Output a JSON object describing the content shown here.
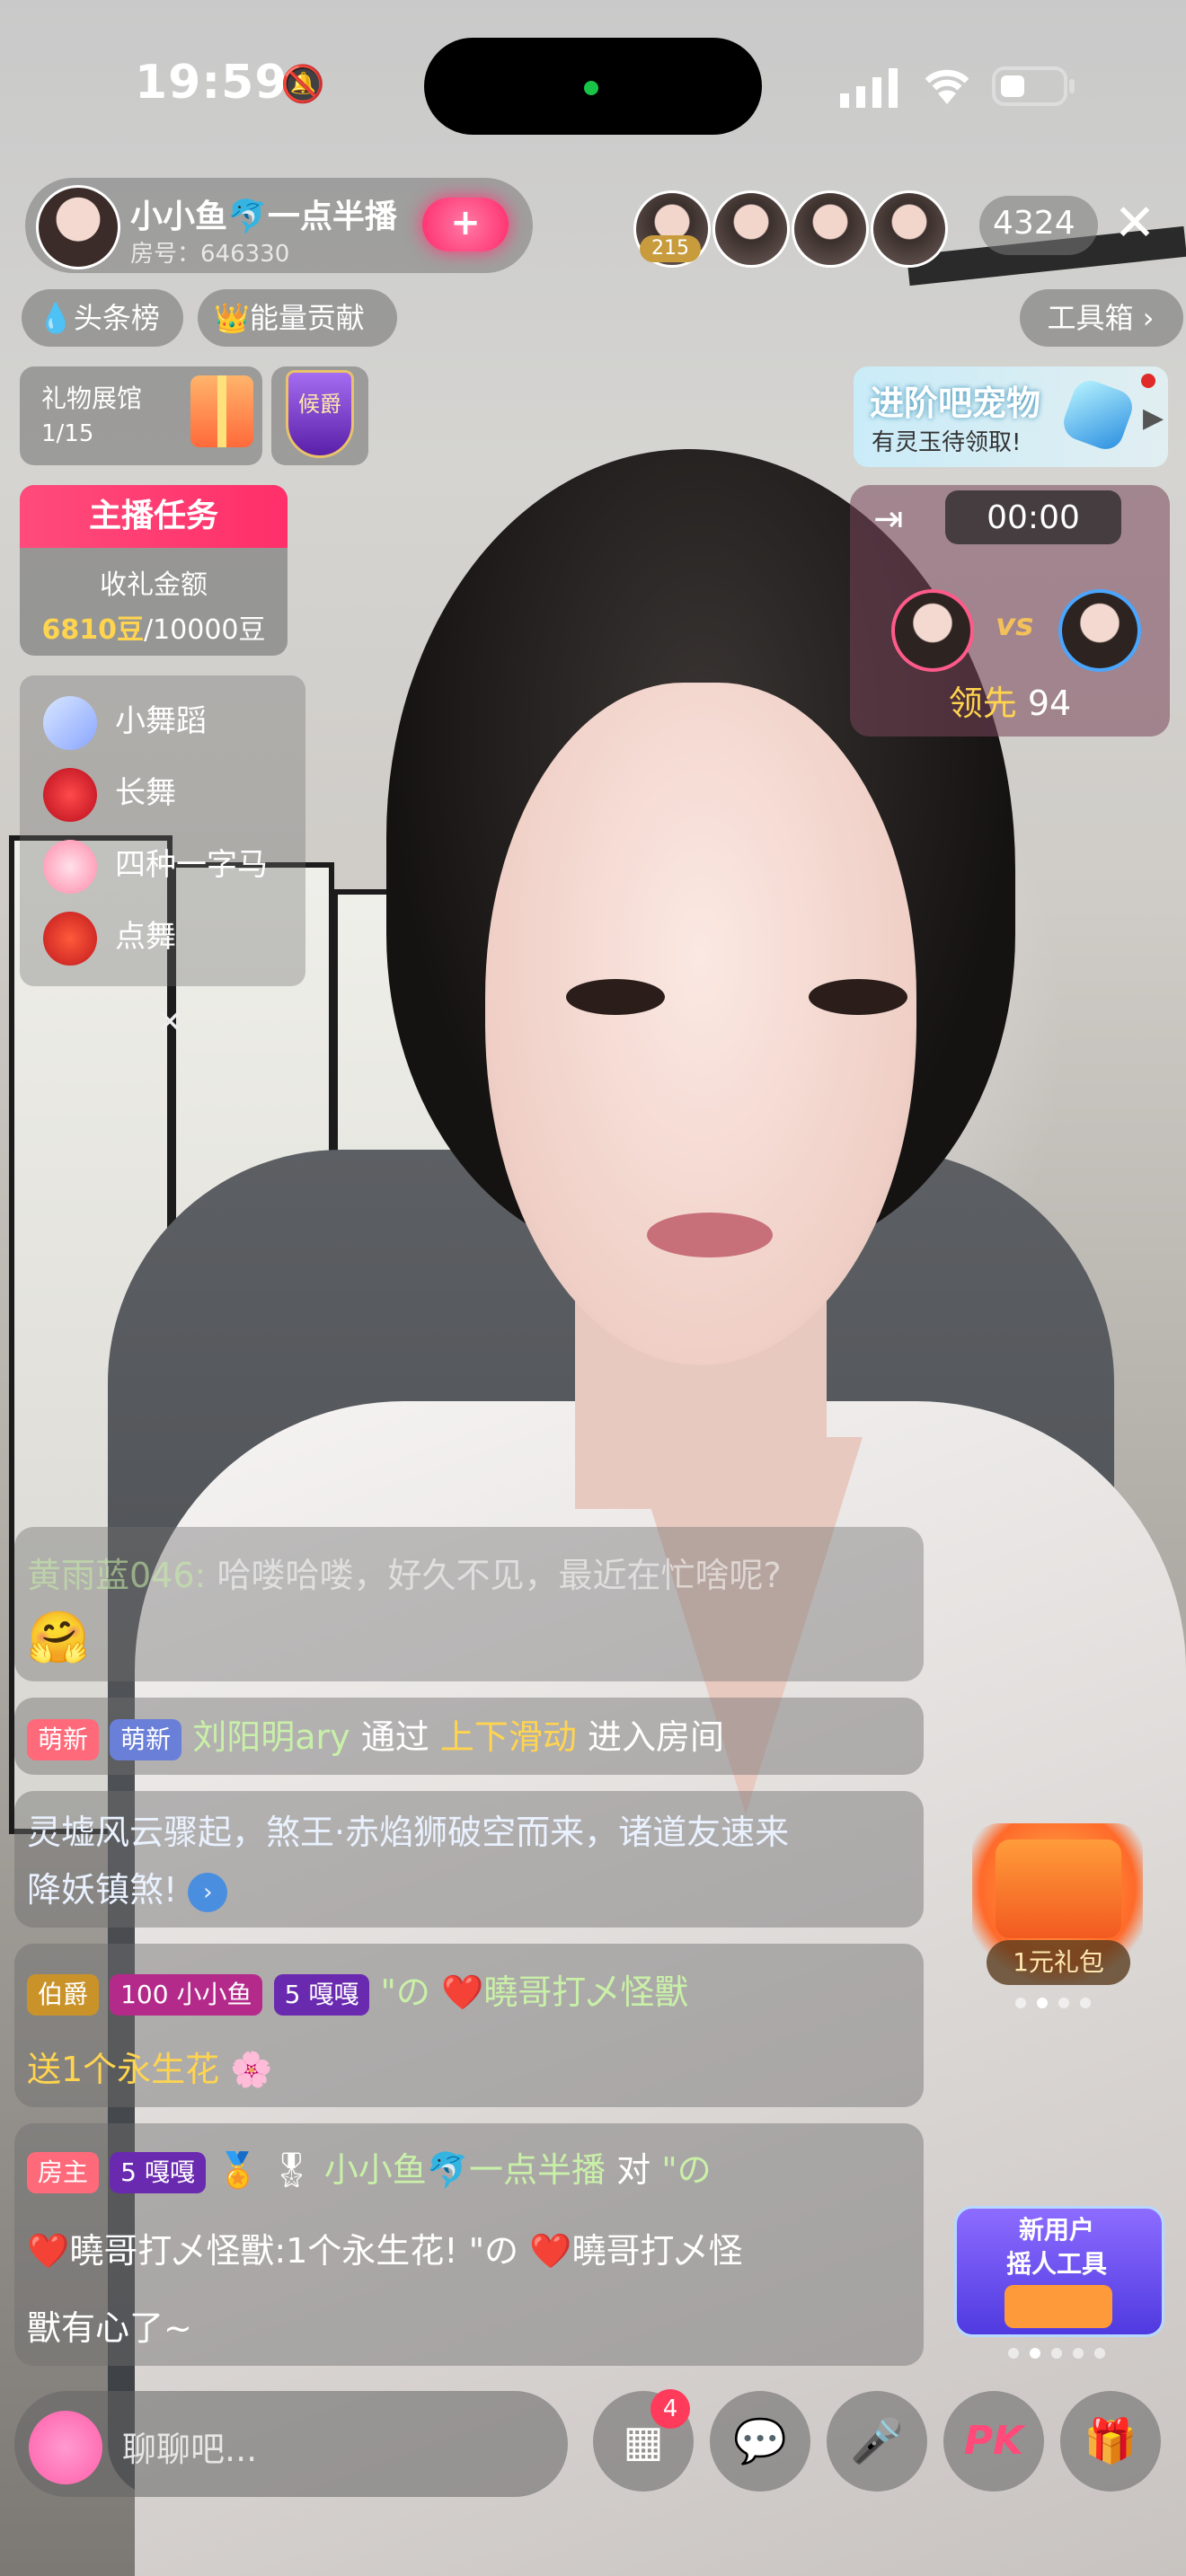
{
  "status_bar": {
    "time": "19:59"
  },
  "host": {
    "name": "小小鱼🐬一点半播",
    "room": "房号：646330",
    "follow_label": "+"
  },
  "viewers": {
    "badge": "215",
    "count": "4324"
  },
  "chips": {
    "headline": "头条榜",
    "energy": "能量贡献",
    "toolbox": "工具箱"
  },
  "gift_hall": {
    "title": "礼物展馆",
    "count": "1/15"
  },
  "rank_badge": {
    "label": "候爵"
  },
  "pet_promo": {
    "title": "进阶吧宠物",
    "subtitle": "有灵玉待领取!"
  },
  "host_task": {
    "title": "主播任务",
    "label": "收礼金额",
    "current": "6810豆",
    "target": "/10000豆"
  },
  "pk": {
    "timer": "00:00",
    "vs": "vs",
    "lead_label": "领先",
    "lead_value": "94"
  },
  "dance_menu": {
    "items": [
      "小舞蹈",
      "长舞",
      "四种一字马",
      "点舞"
    ]
  },
  "chat": {
    "msg1_user": "黄雨蓝046:",
    "msg1_text": "哈喽哈喽，好久不见，最近在忙啥呢?",
    "msg2_tag1": "萌新",
    "msg2_tag2": "萌新",
    "msg2_user": "刘阳明ary",
    "msg2_mid": "通过",
    "msg2_action": "上下滑动",
    "msg2_end": "进入房间",
    "msg3_line1": "灵墟风云骤起，煞王·赤焰狮破空而来，诸道友速来",
    "msg3_line2": "降妖镇煞!",
    "msg4_badge1": "伯爵",
    "msg4_badge2_level": "100",
    "msg4_badge2": "小小鱼",
    "msg4_badge3_level": "5",
    "msg4_badge3": "嘎嘎",
    "msg4_user": "\"の ❤️曉哥打乄怪獸",
    "msg4_text": "送1个永生花",
    "msg5_tag": "房主",
    "msg5_badge_level": "5",
    "msg5_badge": "嘎嘎",
    "msg5_user": "小小鱼🐬一点半播",
    "msg5_mid": "对",
    "msg5_target": "\"の",
    "msg5_line2": "❤️曉哥打乄怪獸:1个永生花! \"の ❤️曉哥打乄怪",
    "msg5_line3": "獸有心了~"
  },
  "red_packet": {
    "label": "1元礼包"
  },
  "new_user": {
    "line1": "新用户",
    "line2": "摇人工具"
  },
  "bottom": {
    "placeholder": "聊聊吧...",
    "apps_badge": "4",
    "pk_label": "PK"
  },
  "colors": {
    "accent_pink": "#ff2f6a",
    "gold": "#ffd44f",
    "nick_green": "#c9f0a8"
  }
}
